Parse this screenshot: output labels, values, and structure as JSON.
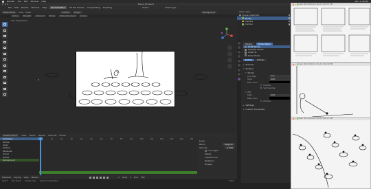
{
  "menubar": {
    "items": [
      "Blender",
      "File",
      "Edit",
      "Window",
      "Help"
    ],
    "right": [
      "Mon 1:49 PM"
    ]
  },
  "window": {
    "title": "Blend_P2.blend"
  },
  "topbar": {
    "menus": [
      "File",
      "Edit",
      "Render",
      "Window",
      "Help"
    ],
    "tabs": [
      "2D Animation",
      "2D Full Canvas",
      "Compositing",
      "Scripting"
    ],
    "active_tab": "2D Animation",
    "scene": "Scene",
    "view_layer": "View Layer"
  },
  "viewport": {
    "mode": "Draw Mode",
    "menus": [
      "View",
      "Draw"
    ],
    "brush": "Ink Pen",
    "origin": "Origin",
    "layer": "Background",
    "sub_items": [
      "Radius",
      "Strength",
      "Advanced",
      "Stroke",
      "Stroke Placement",
      "Guides"
    ],
    "perspective": "User Perspective"
  },
  "dopesheet": {
    "mode": "Grease Pencil",
    "menus": [
      "View",
      "Select",
      "Marker",
      "Channel",
      "Frame"
    ],
    "channels": [
      {
        "label": "Summary",
        "type": "head"
      },
      {
        "label": "Stroke",
        "type": "normal"
      },
      {
        "label": "Lines",
        "type": "normal"
      },
      {
        "label": "Outline",
        "type": "normal"
      },
      {
        "label": "Students",
        "type": "normal"
      },
      {
        "label": "Cloud",
        "type": "normal"
      },
      {
        "label": "Desks",
        "type": "normal"
      },
      {
        "label": "Background",
        "type": "hl"
      }
    ],
    "current_frame": "1",
    "ruler": [
      "0",
      "10",
      "20",
      "30",
      "40",
      "50",
      "60",
      "70",
      "80",
      "90",
      "100",
      "110",
      "120",
      "130",
      "140",
      "150"
    ],
    "layer_panel": {
      "title": "Layer",
      "blend_label": "Blend",
      "blend_value": "Regular",
      "opacity_label": "Opacity",
      "opacity_value": "1.000",
      "use_lights": "Use Lights",
      "sections": [
        "Masks",
        "Adjustments",
        "Relations",
        "Display"
      ]
    }
  },
  "playback": {
    "items": [
      "Playback",
      "Keying",
      "View",
      "Marker"
    ],
    "start_label": "Start",
    "start": "1",
    "end_label": "End",
    "end": "250",
    "frame": "1"
  },
  "statusbar": {
    "items": [
      "Select",
      "Box Select",
      "Rotate View",
      "Object Context Menu"
    ],
    "version": "2.83.0"
  },
  "outliner": {
    "search": "View Layer",
    "rows": [
      {
        "label": "Scene Collection",
        "sel": false,
        "color": "#888888"
      },
      {
        "label": "Stroke",
        "sel": true,
        "color": "#7db04d"
      },
      {
        "label": "Camera",
        "sel": false,
        "color": "#d4a04a"
      },
      {
        "label": "Contour",
        "sel": false,
        "color": "#7db04d"
      }
    ]
  },
  "properties": {
    "pills": [
      "Stroke",
      "Stroke Basic"
    ],
    "materials": [
      {
        "label": "Solid Stroke",
        "color": "#000000",
        "sel": true
      },
      {
        "label": "Squares Stroke",
        "color": "#b33b3b",
        "sel": false
      },
      {
        "label": "Solid Fill",
        "color": "#777777",
        "sel": false
      },
      {
        "label": "Dots Stroke",
        "color": "#222222",
        "sel": false
      }
    ],
    "mode_tabs": [
      "Surface",
      "Settings"
    ],
    "active_mode": "Surface",
    "sections": {
      "preview": "Preview",
      "surface": "Surface",
      "stroke": "Stroke",
      "fill": "Fill",
      "settings": "Settings",
      "custom": "Custom Properties"
    },
    "stroke_fields": [
      {
        "label": "Line Type",
        "value": "Line",
        "style": "normal"
      },
      {
        "label": "Style",
        "value": "Solid",
        "style": "normal"
      },
      {
        "label": "Base Color",
        "value": "",
        "style": "black"
      }
    ],
    "stroke_checks": [
      {
        "label": "Holdout",
        "on": false
      },
      {
        "label": "Self Overlap",
        "on": true
      }
    ],
    "fill_fields": [
      {
        "label": "Style",
        "value": "Solid",
        "style": "normal"
      },
      {
        "label": "Base Color",
        "value": "",
        "style": "black"
      }
    ],
    "fill_checks": [
      {
        "label": "Holdout",
        "on": false
      }
    ]
  },
  "previews": [
    {
      "title": "Screen Shot 2020-10-16 at 12.03.57 PM"
    },
    {
      "title": "Screen Shot 2020-10-16 at 12.04.30 PM"
    },
    {
      "title": "Screen Shot 2020-10-16 at 12.05.17 PM"
    }
  ],
  "colors": {
    "accent": "#4772b3",
    "selection": "#3d5f8a",
    "keyframe_bar": "#3e7d2a",
    "playhead": "#4a90d9"
  }
}
